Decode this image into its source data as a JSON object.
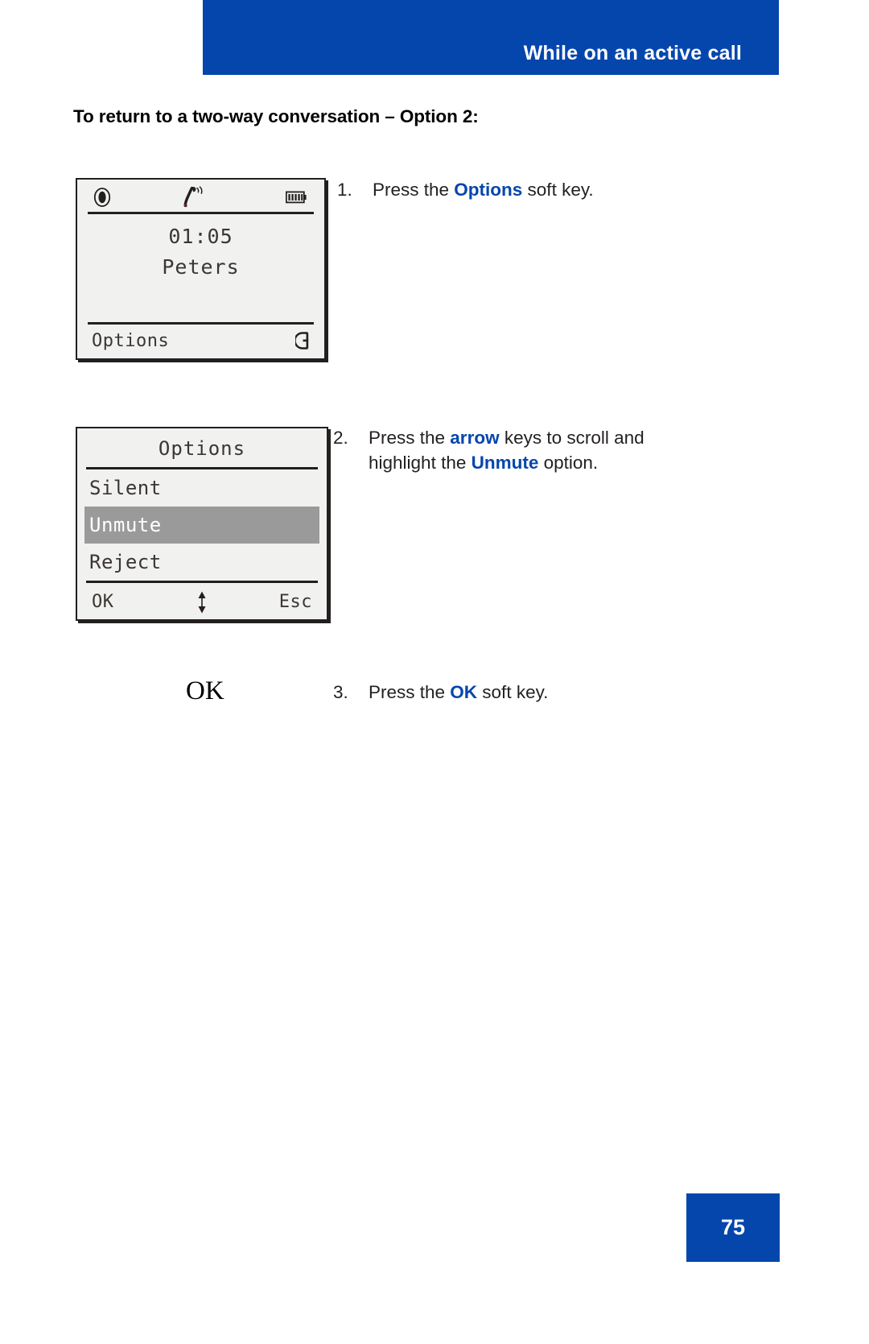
{
  "header": {
    "title": "While on an active call"
  },
  "section": {
    "heading": "To return to a two-way conversation – Option 2:"
  },
  "screens": {
    "call": {
      "timer": "01:05",
      "caller_name": "Peters",
      "softkey_left": "Options",
      "icons": {
        "mute": "mute-icon",
        "handset": "active-call-handset-icon",
        "battery": "battery-icon",
        "speaker": "speaker-icon"
      }
    },
    "options": {
      "title": "Options",
      "items": [
        {
          "label": "Silent",
          "selected": false
        },
        {
          "label": "Unmute",
          "selected": true
        },
        {
          "label": "Reject",
          "selected": false
        }
      ],
      "softkey_left": "OK",
      "softkey_right": "Esc",
      "scroll_icon": "up-down-arrows-icon"
    }
  },
  "ok_label": "OK",
  "steps": [
    {
      "number": "1.",
      "before": "Press the ",
      "keyword": "Options",
      "after": " soft key.",
      "line2_before": "",
      "line2_keyword": "",
      "line2_after": ""
    },
    {
      "number": "2.",
      "before": "Press the ",
      "keyword": "arrow",
      "after": " keys to scroll and",
      "line2_before": "highlight the ",
      "line2_keyword": "Unmute",
      "line2_after": " option."
    },
    {
      "number": "3.",
      "before": "Press the ",
      "keyword": "OK",
      "after": " soft key.",
      "line2_before": "",
      "line2_keyword": "",
      "line2_after": ""
    }
  ],
  "footer": {
    "page_number": "75"
  },
  "colors": {
    "brand_blue": "#0546ad",
    "lcd_background": "#f1f2f0",
    "lcd_ink": "#3b3634",
    "highlight_gray": "#9a9a9a"
  }
}
